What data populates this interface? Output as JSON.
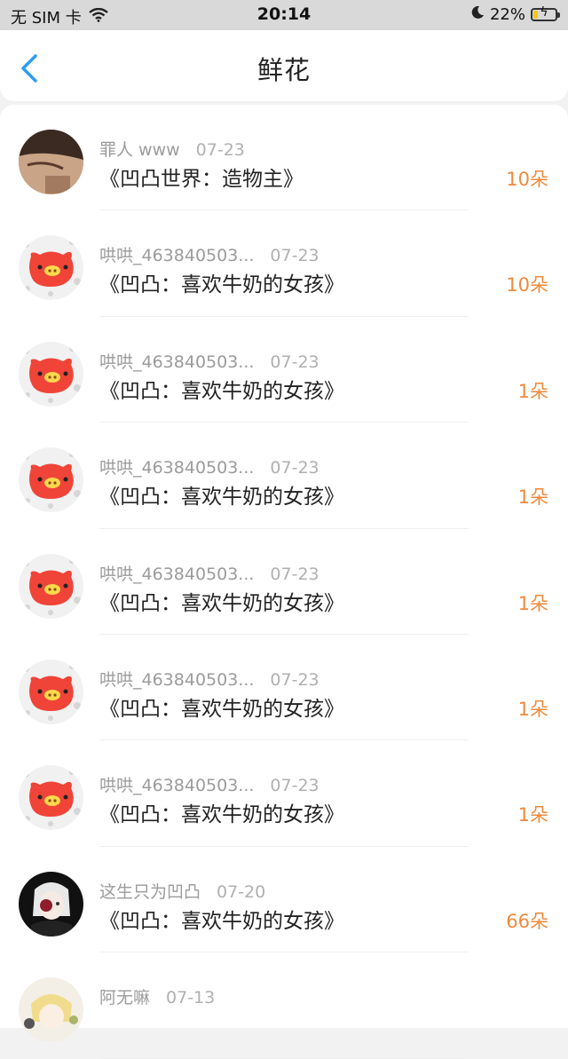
{
  "status_bar": {
    "carrier": "无 SIM 卡",
    "time": "20:14",
    "battery": "22%",
    "battery_level": 0.22
  },
  "header": {
    "title": "鲜花"
  },
  "colors": {
    "accent_blue": "#2d9ef0",
    "count_orange": "#f08a3c"
  },
  "items": [
    {
      "user": "罪人 www",
      "date": "07-23",
      "work": "《凹凸世界：造物主》",
      "count": "10朵",
      "avatar": "photo-face"
    },
    {
      "user": "哄哄_463840503...",
      "date": "07-23",
      "work": "《凹凸：喜欢牛奶的女孩》",
      "count": "10朵",
      "avatar": "red-pig"
    },
    {
      "user": "哄哄_463840503...",
      "date": "07-23",
      "work": "《凹凸：喜欢牛奶的女孩》",
      "count": "1朵",
      "avatar": "red-pig"
    },
    {
      "user": "哄哄_463840503...",
      "date": "07-23",
      "work": "《凹凸：喜欢牛奶的女孩》",
      "count": "1朵",
      "avatar": "red-pig"
    },
    {
      "user": "哄哄_463840503...",
      "date": "07-23",
      "work": "《凹凸：喜欢牛奶的女孩》",
      "count": "1朵",
      "avatar": "red-pig"
    },
    {
      "user": "哄哄_463840503...",
      "date": "07-23",
      "work": "《凹凸：喜欢牛奶的女孩》",
      "count": "1朵",
      "avatar": "red-pig"
    },
    {
      "user": "哄哄_463840503...",
      "date": "07-23",
      "work": "《凹凸：喜欢牛奶的女孩》",
      "count": "1朵",
      "avatar": "red-pig"
    },
    {
      "user": "这生只为凹凸",
      "date": "07-20",
      "work": "《凹凸：喜欢牛奶的女孩》",
      "count": "66朵",
      "avatar": "anime-dark"
    },
    {
      "user": "阿无嘛",
      "date": "07-13",
      "work": "",
      "count": "",
      "avatar": "anime-light"
    }
  ]
}
